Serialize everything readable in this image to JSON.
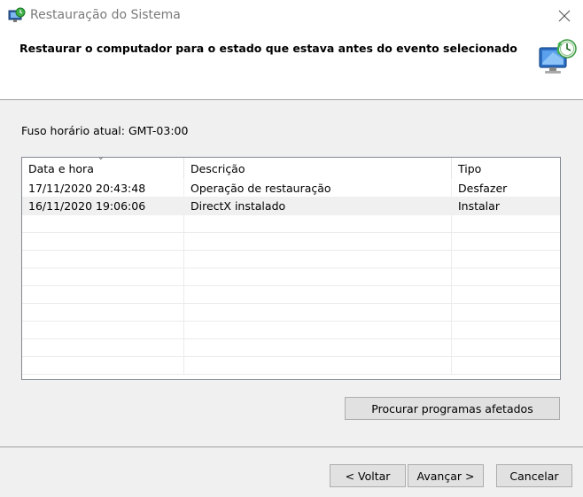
{
  "window": {
    "title": "Restauração do Sistema",
    "icon": "system-restore-icon",
    "close_icon": "close-icon"
  },
  "header": {
    "title": "Restaurar o computador para o estado que estava antes do evento selecionado",
    "icon": "system-restore-monitor-icon"
  },
  "timezone_label": "Fuso horário atual: GMT-03:00",
  "list": {
    "columns": [
      "Data e hora",
      "Descrição",
      "Tipo"
    ],
    "sort_indicator": "⌄",
    "rows": [
      {
        "date": "17/11/2020 20:43:48",
        "description": "Operação de restauração",
        "type": "Desfazer"
      },
      {
        "date": "16/11/2020 19:06:06",
        "description": "DirectX instalado",
        "type": "Instalar"
      }
    ]
  },
  "buttons": {
    "affected": "Procurar programas afetados",
    "back": "< Voltar",
    "next": "Avançar >",
    "cancel": "Cancelar"
  },
  "colors": {
    "header_bg": "#ffffff",
    "body_bg": "#f0f0f0",
    "button_bg": "#e1e1e1",
    "button_border": "#adadad",
    "selected_row": "#f0f0f0"
  }
}
